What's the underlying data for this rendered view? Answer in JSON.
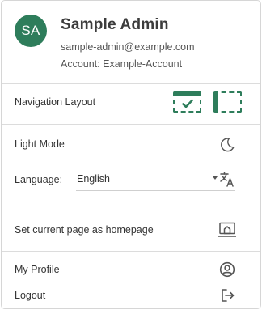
{
  "header": {
    "avatar_initials": "SA",
    "name": "Sample Admin",
    "email": "sample-admin@example.com",
    "account": "Account: Example-Account"
  },
  "navigation_layout": {
    "label": "Navigation Layout",
    "options": [
      {
        "name": "top-bar",
        "selected": true,
        "icon": "layout-top-icon"
      },
      {
        "name": "side-bar",
        "selected": false,
        "icon": "layout-side-icon"
      }
    ]
  },
  "theme": {
    "label": "Light Mode",
    "icon": "moon-icon"
  },
  "language": {
    "label": "Language:",
    "selected": "English",
    "icon": "translate-icon"
  },
  "homepage": {
    "label": "Set current page as homepage",
    "icon": "home-screen-icon"
  },
  "profile": {
    "label": "My Profile",
    "icon": "account-circle-icon"
  },
  "logout": {
    "label": "Logout",
    "icon": "logout-icon"
  },
  "colors": {
    "accent": "#2e7d5b",
    "icon": "#555555",
    "divider": "#dcdcdc"
  }
}
